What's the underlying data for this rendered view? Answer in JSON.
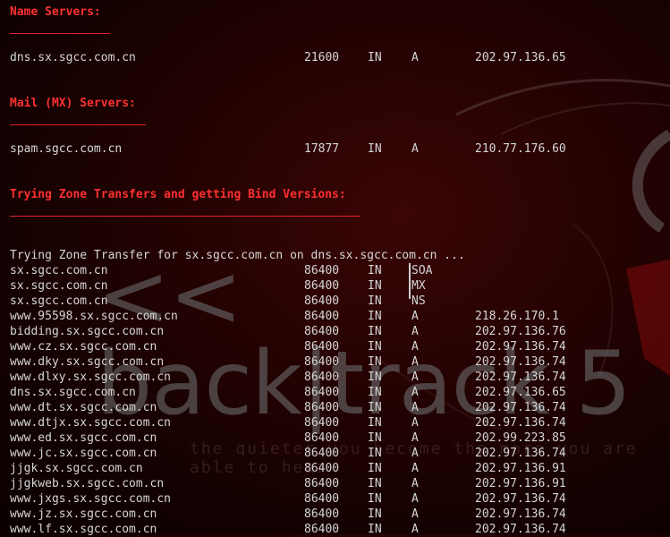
{
  "wallpaper": {
    "logo_text": "<< back|track 5",
    "tagline": "the quieter you become the more you are able to hear"
  },
  "sections": {
    "name_servers": {
      "header": "Name Servers:",
      "record": {
        "host": "dns.sx.sgcc.com.cn",
        "ttl": "21600",
        "class": "IN",
        "type": "A",
        "ip": "202.97.136.65"
      }
    },
    "mail_servers": {
      "header": "Mail (MX) Servers:",
      "record": {
        "host": "spam.sgcc.com.cn",
        "ttl": "17877",
        "class": "IN",
        "type": "A",
        "ip": "210.77.176.60"
      }
    },
    "zone_transfers": {
      "header": "Trying Zone Transfers and getting Bind Versions:",
      "status": "Trying Zone Transfer for sx.sgcc.com.cn on dns.sx.sgcc.com.cn ...",
      "records": [
        {
          "host": "sx.sgcc.com.cn",
          "ttl": "86400",
          "class": "IN",
          "type": "SOA",
          "ip": ""
        },
        {
          "host": "sx.sgcc.com.cn",
          "ttl": "86400",
          "class": "IN",
          "type": "MX",
          "ip": ""
        },
        {
          "host": "sx.sgcc.com.cn",
          "ttl": "86400",
          "class": "IN",
          "type": "NS",
          "ip": ""
        },
        {
          "host": "www.95598.sx.sgcc.com.cn",
          "ttl": "86400",
          "class": "IN",
          "type": "A",
          "ip": "218.26.170.1"
        },
        {
          "host": "bidding.sx.sgcc.com.cn",
          "ttl": "86400",
          "class": "IN",
          "type": "A",
          "ip": "202.97.136.76"
        },
        {
          "host": "www.cz.sx.sgcc.com.cn",
          "ttl": "86400",
          "class": "IN",
          "type": "A",
          "ip": "202.97.136.74"
        },
        {
          "host": "www.dky.sx.sgcc.com.cn",
          "ttl": "86400",
          "class": "IN",
          "type": "A",
          "ip": "202.97.136.74"
        },
        {
          "host": "www.dlxy.sx.sgcc.com.cn",
          "ttl": "86400",
          "class": "IN",
          "type": "A",
          "ip": "202.97.136.74"
        },
        {
          "host": "dns.sx.sgcc.com.cn",
          "ttl": "86400",
          "class": "IN",
          "type": "A",
          "ip": "202.97.136.65"
        },
        {
          "host": "www.dt.sx.sgcc.com.cn",
          "ttl": "86400",
          "class": "IN",
          "type": "A",
          "ip": "202.97.136.74"
        },
        {
          "host": "www.dtjx.sx.sgcc.com.cn",
          "ttl": "86400",
          "class": "IN",
          "type": "A",
          "ip": "202.97.136.74"
        },
        {
          "host": "www.ed.sx.sgcc.com.cn",
          "ttl": "86400",
          "class": "IN",
          "type": "A",
          "ip": "202.99.223.85"
        },
        {
          "host": "www.jc.sx.sgcc.com.cn",
          "ttl": "86400",
          "class": "IN",
          "type": "A",
          "ip": "202.97.136.74"
        },
        {
          "host": "jjgk.sx.sgcc.com.cn",
          "ttl": "86400",
          "class": "IN",
          "type": "A",
          "ip": "202.97.136.91"
        },
        {
          "host": "jjgkweb.sx.sgcc.com.cn",
          "ttl": "86400",
          "class": "IN",
          "type": "A",
          "ip": "202.97.136.91"
        },
        {
          "host": "www.jxgs.sx.sgcc.com.cn",
          "ttl": "86400",
          "class": "IN",
          "type": "A",
          "ip": "202.97.136.74"
        },
        {
          "host": "www.jz.sx.sgcc.com.cn",
          "ttl": "86400",
          "class": "IN",
          "type": "A",
          "ip": "202.97.136.74"
        },
        {
          "host": "www.lf.sx.sgcc.com.cn",
          "ttl": "86400",
          "class": "IN",
          "type": "A",
          "ip": "202.97.136.74"
        }
      ]
    }
  },
  "colors": {
    "header": "#ff3030",
    "text": "#d6d6d6",
    "background": "#1a0202"
  }
}
